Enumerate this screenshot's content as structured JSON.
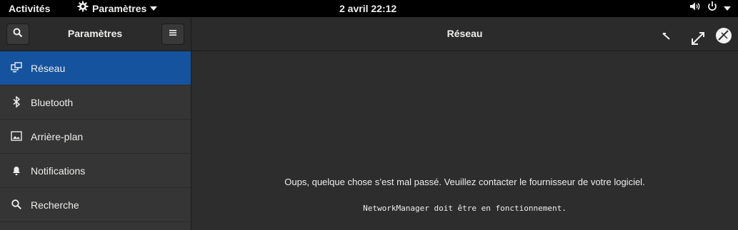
{
  "topbar": {
    "activities": "Activités",
    "app_menu": "Paramètres",
    "clock": "2 avril  22:12",
    "icons": [
      "gear-icon",
      "volume-icon",
      "power-icon",
      "chevron-down-icon"
    ]
  },
  "header": {
    "sidebar_title": "Paramètres",
    "panel_title": "Réseau",
    "icons": [
      "search-icon",
      "hamburger-menu-icon",
      "window-icons"
    ]
  },
  "sidebar": {
    "items": [
      {
        "label": "Réseau",
        "icon": "network-icon",
        "active": true
      },
      {
        "label": "Bluetooth",
        "icon": "bluetooth-icon",
        "active": false
      },
      {
        "label": "Arrière-plan",
        "icon": "image-icon",
        "active": false
      },
      {
        "label": "Notifications",
        "icon": "bell-icon",
        "active": false
      },
      {
        "label": "Recherche",
        "icon": "search-icon",
        "active": false
      }
    ]
  },
  "main": {
    "error_message": "Oups, quelque chose s’est mal passé. Veuillez contacter le fournisseur de votre logiciel.",
    "error_detail": "NetworkManager doit être en fonctionnement."
  },
  "colors": {
    "selection": "#15539e",
    "background": "#2d2d2d",
    "sidebar": "#353535",
    "topbar": "#000000"
  }
}
